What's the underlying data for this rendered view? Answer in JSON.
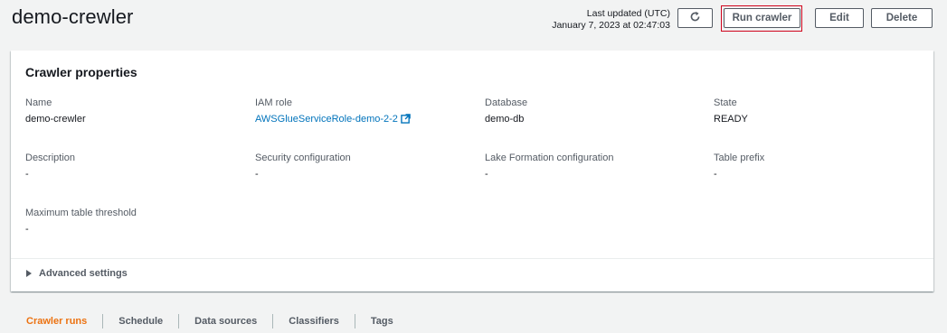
{
  "page": {
    "title": "demo-crewler"
  },
  "header": {
    "updated_label": "Last updated (UTC)",
    "updated_time": "January 7, 2023 at 02:47:03",
    "buttons": {
      "refresh_icon": "refresh-icon",
      "run": "Run crawler",
      "edit": "Edit",
      "delete": "Delete"
    }
  },
  "properties": {
    "title": "Crawler properties",
    "fields": {
      "name": {
        "label": "Name",
        "value": "demo-crewler"
      },
      "iam_role": {
        "label": "IAM role",
        "value": "AWSGlueServiceRole-demo-2-2"
      },
      "database": {
        "label": "Database",
        "value": "demo-db"
      },
      "state": {
        "label": "State",
        "value": "READY"
      },
      "description": {
        "label": "Description",
        "value": "-"
      },
      "security": {
        "label": "Security configuration",
        "value": "-"
      },
      "lake_formation": {
        "label": "Lake Formation configuration",
        "value": "-"
      },
      "table_prefix": {
        "label": "Table prefix",
        "value": "-"
      },
      "max_threshold": {
        "label": "Maximum table threshold",
        "value": "-"
      }
    },
    "advanced_label": "Advanced settings"
  },
  "tabs": [
    {
      "label": "Crawler runs",
      "active": true
    },
    {
      "label": "Schedule",
      "active": false
    },
    {
      "label": "Data sources",
      "active": false
    },
    {
      "label": "Classifiers",
      "active": false
    },
    {
      "label": "Tags",
      "active": false
    }
  ],
  "colors": {
    "link": "#0073bb",
    "active_tab": "#ec7211",
    "highlight_box": "#d0021b",
    "background": "#f2f3f3"
  }
}
